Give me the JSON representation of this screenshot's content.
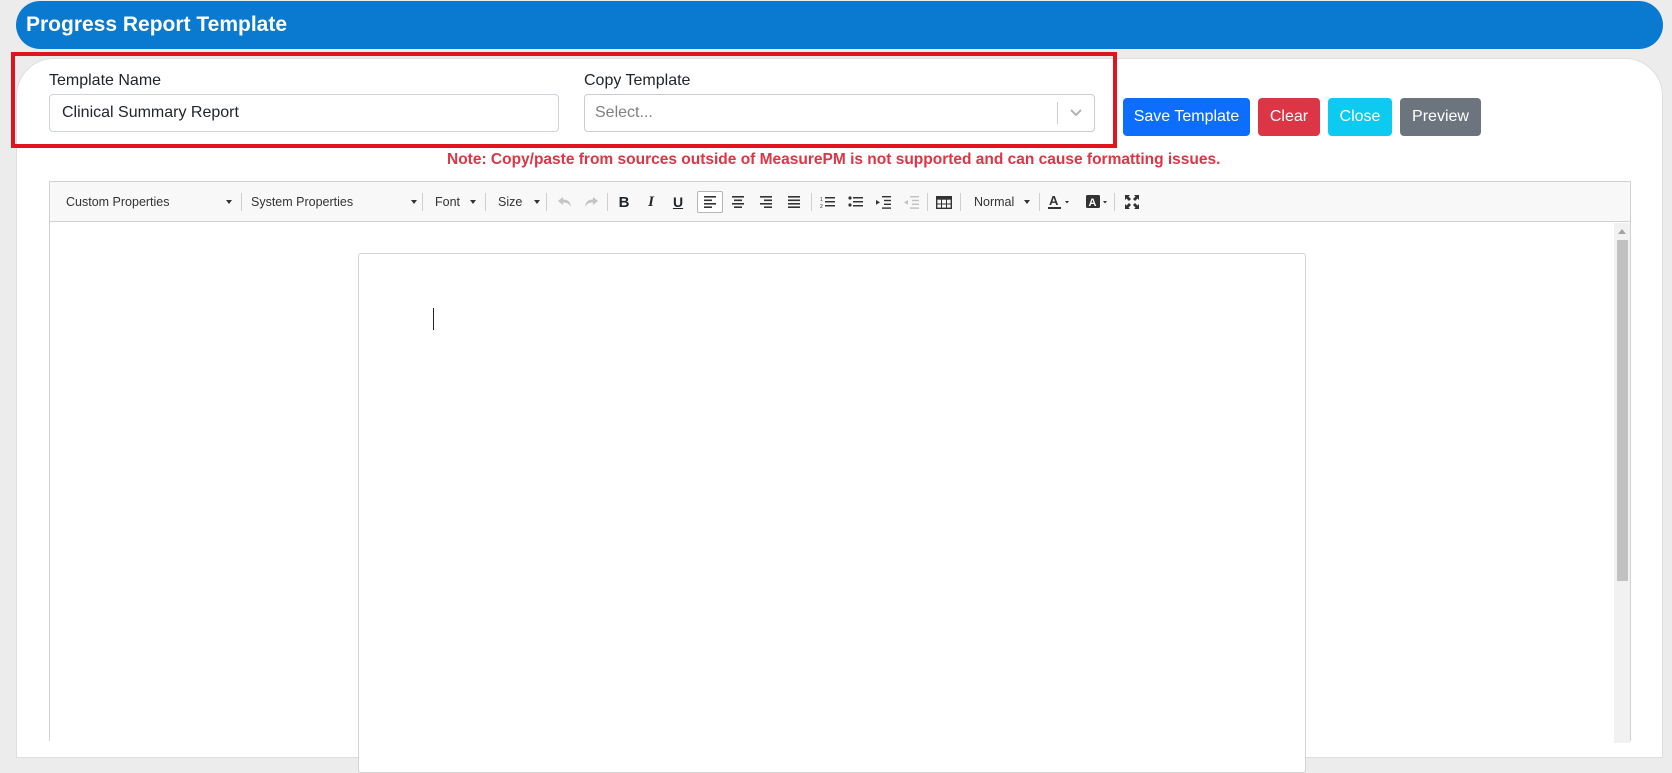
{
  "header": {
    "title": "Progress Report Template"
  },
  "form": {
    "template_name_label": "Template Name",
    "template_name_value": "Clinical Summary Report",
    "copy_template_label": "Copy Template",
    "copy_template_placeholder": "Select..."
  },
  "buttons": {
    "save": "Save Template",
    "clear": "Clear",
    "close": "Close",
    "preview": "Preview"
  },
  "colors": {
    "header": "#0a7ad0",
    "save": "#0d6efd",
    "clear": "#dc3545",
    "close": "#0dcaf0",
    "preview": "#6c757d",
    "note": "#dc3545",
    "highlight": "#e0141e"
  },
  "note": "Note: Copy/paste from sources outside of MeasurePM is not supported and can cause formatting issues.",
  "toolbar": {
    "custom_properties": "Custom Properties",
    "system_properties": "System Properties",
    "font": "Font",
    "size": "Size",
    "paragraph_format": "Normal",
    "icons": [
      "undo-icon",
      "redo-icon",
      "bold-icon",
      "italic-icon",
      "underline-icon",
      "align-left-icon",
      "align-center-icon",
      "align-right-icon",
      "align-justify-icon",
      "ordered-list-icon",
      "unordered-list-icon",
      "indent-icon",
      "outdent-icon",
      "table-icon",
      "text-color-icon",
      "background-color-icon",
      "fullscreen-icon"
    ]
  }
}
